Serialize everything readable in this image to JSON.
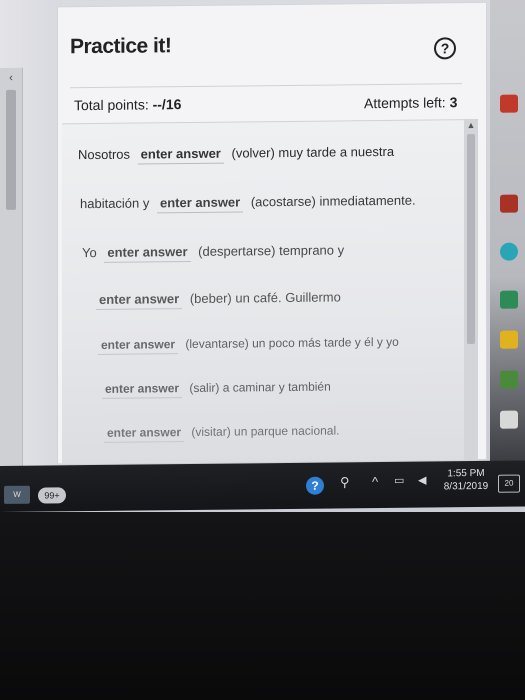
{
  "window": {
    "title": "Practice it!",
    "help_glyph": "?"
  },
  "stats": {
    "points_label": "Total points:",
    "points_value": "--/16",
    "attempts_label": "Attempts left:",
    "attempts_value": "3"
  },
  "exercise": {
    "lines": [
      {
        "before": "Nosotros",
        "answer": "enter answer",
        "after": "(volver) muy tarde a nuestra"
      },
      {
        "before": "habitación y",
        "answer": "enter answer",
        "after": "(acostarse) inmediatamente."
      },
      {
        "before": "Yo",
        "answer": "enter answer",
        "after": "(despertarse) temprano y"
      },
      {
        "before": "",
        "answer": "enter answer",
        "after": "(beber) un café. Guillermo"
      },
      {
        "before": "",
        "answer": "enter answer",
        "after": "(levantarse) un poco más tarde y él y yo"
      },
      {
        "before": "",
        "answer": "enter answer",
        "after": "(salir) a caminar y también"
      },
      {
        "before": "",
        "answer": "enter answer",
        "after": "(visitar) un parque nacional."
      }
    ]
  },
  "taskbar": {
    "badge": "99+",
    "win_tile": "W",
    "help_glyph": "?",
    "time": "1:55 PM",
    "date": "8/31/2019",
    "notifications": "20"
  },
  "colors": {
    "panel_bg": "#f4f4f6",
    "taskbar_bg": "#1f2024",
    "help_blue": "#2f7fd2"
  }
}
